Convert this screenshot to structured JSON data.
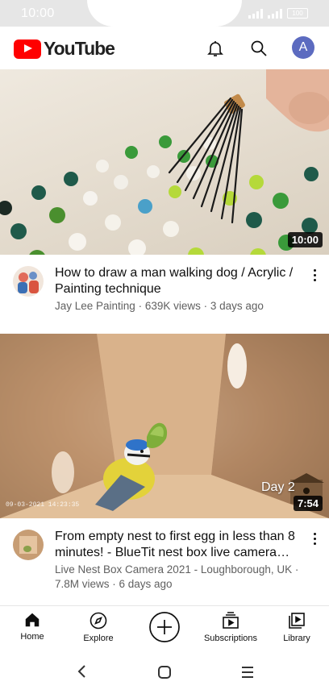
{
  "status": {
    "time": "10:00",
    "battery": "100"
  },
  "header": {
    "brand": "YouTube",
    "avatar_letter": "A"
  },
  "videos": [
    {
      "title": "How to draw a man walking dog / Acrylic / Painting technique",
      "subtitle": "Jay Lee Painting · 639K views · 3 days ago",
      "duration": "10:00"
    },
    {
      "title": "From empty nest to first egg in less than 8 minutes! - BlueTit nest box live camera…",
      "subtitle": "Live Nest Box Camera 2021 - Loughborough, UK · 7.8M views · 6 days ago",
      "duration": "7:54",
      "overlay": "Day 2",
      "timestamp": "09-03-2021 14:23:35"
    }
  ],
  "nav": {
    "home": "Home",
    "explore": "Explore",
    "subscriptions": "Subscriptions",
    "library": "Library"
  },
  "icons": [
    "bell-icon",
    "search-icon",
    "home-icon",
    "explore-icon",
    "create-icon",
    "subscriptions-icon",
    "library-icon",
    "back-icon",
    "home-circle-icon",
    "recents-icon",
    "more-icon"
  ],
  "colors": {
    "accent": "#ff0000",
    "avatar": "#5c6bc0",
    "secondary_text": "#606060"
  }
}
